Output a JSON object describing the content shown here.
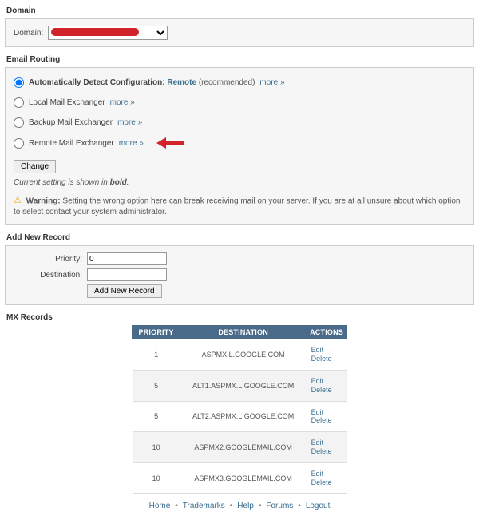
{
  "domain_section": {
    "title": "Domain",
    "label": "Domain:"
  },
  "routing": {
    "title": "Email Routing",
    "options": {
      "auto": {
        "label_prefix": "Automatically Detect Configuration:",
        "detected": "Remote",
        "recommended": "(recommended)",
        "more": "more »"
      },
      "local": {
        "label": "Local Mail Exchanger",
        "more": "more »"
      },
      "backup": {
        "label": "Backup Mail Exchanger",
        "more": "more »"
      },
      "remote": {
        "label": "Remote Mail Exchanger",
        "more": "more »"
      }
    },
    "change_btn": "Change",
    "note_prefix": "Current setting is shown in ",
    "note_bold": "bold",
    "note_suffix": ".",
    "warning_label": "Warning:",
    "warning_text": " Setting the wrong option here can break receiving mail on your server. If you are at all unsure about which option to select contact your system administrator."
  },
  "add_record": {
    "title": "Add New Record",
    "priority_label": "Priority:",
    "priority_value": "0",
    "destination_label": "Destination:",
    "destination_value": "",
    "button": "Add New Record"
  },
  "mx": {
    "title": "MX Records",
    "headers": {
      "priority": "PRIORITY",
      "destination": "DESTINATION",
      "actions": "ACTIONS"
    },
    "action_edit": "Edit",
    "action_delete": "Delete",
    "rows": [
      {
        "priority": "1",
        "destination": "ASPMX.L.GOOGLE.COM"
      },
      {
        "priority": "5",
        "destination": "ALT1.ASPMX.L.GOOGLE.COM"
      },
      {
        "priority": "5",
        "destination": "ALT2.ASPMX.L.GOOGLE.COM"
      },
      {
        "priority": "10",
        "destination": "ASPMX2.GOOGLEMAIL.COM"
      },
      {
        "priority": "10",
        "destination": "ASPMX3.GOOGLEMAIL.COM"
      }
    ]
  },
  "footer": {
    "links": [
      "Home",
      "Trademarks",
      "Help",
      "Forums",
      "Logout"
    ]
  }
}
